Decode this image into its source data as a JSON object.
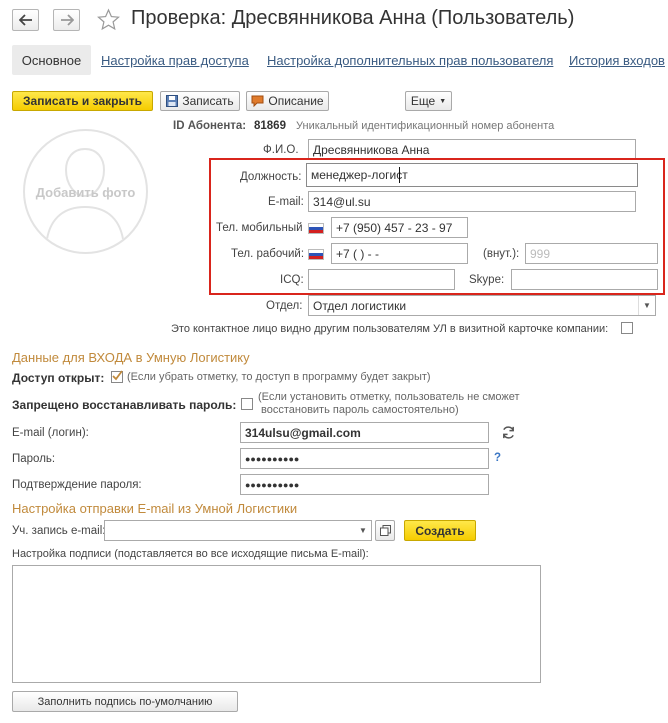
{
  "window": {
    "title": "Проверка: Дресвянникова Анна (Пользователь)"
  },
  "tabs": [
    {
      "label": "Основное",
      "active": true
    },
    {
      "label": "Настройка прав доступа"
    },
    {
      "label": "Настройка дополнительных прав пользователя"
    },
    {
      "label": "История входов"
    }
  ],
  "toolbar": {
    "save_close": "Записать и закрыть",
    "save": "Записать",
    "description": "Описание",
    "more": "Еще"
  },
  "header": {
    "id_label": "ID Абонента:",
    "id_value": "81869",
    "id_hint": "Уникальный идентификационный номер абонента"
  },
  "photo": {
    "label": "Добавить фото"
  },
  "fields": {
    "fio": {
      "label": "Ф.И.О.",
      "value": "Дресвянникова Анна"
    },
    "position": {
      "label": "Должность:",
      "value": "менеджер-логист"
    },
    "email": {
      "label": "E-mail:",
      "value": "314@ul.su"
    },
    "mobile": {
      "label": "Тел. мобильный",
      "value": "+7 (950) 457 - 23 - 97"
    },
    "work_phone": {
      "label": "Тел. рабочий:",
      "value": "+7 (   )    -   -"
    },
    "ext": {
      "label": "(внут.):",
      "placeholder": "999"
    },
    "icq": {
      "label": "ICQ:",
      "value": ""
    },
    "skype": {
      "label": "Skype:",
      "value": ""
    },
    "department": {
      "label": "Отдел:",
      "value": "Отдел логистики"
    }
  },
  "visibility": {
    "label": "Это контактное лицо видно другим пользователям УЛ в визитной карточке компании:"
  },
  "login_section": {
    "title": "Данные для ВХОДА в Умную Логистику",
    "access_label": "Доступ открыт:",
    "access_hint": "(Если убрать отметку, то доступ в программу будет закрыт)",
    "restore_label": "Запрещено восстанавливать пароль:",
    "restore_hint_1": "(Если установить отметку, пользователь не сможет",
    "restore_hint_2": "восстановить пароль самостоятельно)",
    "email_label": "E-mail (логин):",
    "email_value": "314ulsu@gmail.com",
    "password_label": "Пароль:",
    "password_value": "●●●●●●●●●●",
    "password_help": "?",
    "confirm_label": "Подтверждение пароля:",
    "confirm_value": "●●●●●●●●●●"
  },
  "email_section": {
    "title": "Настройка отправки E-mail из Умной Логистики",
    "account_label": "Уч. запись e-mail:",
    "account_value": "",
    "create_button": "Создать",
    "signature_label": "Настройка подписи (подставляется во все исходящие письма E-mail):",
    "signature_value": "",
    "fill_default_button": "Заполнить подпись по-умолчанию"
  },
  "colors": {
    "accent_section": "#c18a3c",
    "highlight_frame": "#d9251c",
    "link": "#3a5b82",
    "primary_button": "#f5cc00"
  }
}
